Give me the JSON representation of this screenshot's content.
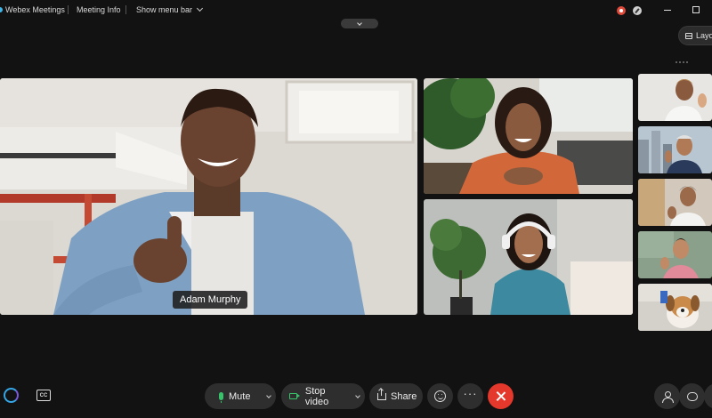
{
  "window": {
    "app_title": "Webex Meetings",
    "meeting_info_label": "Meeting Info",
    "menu_bar_label": "Show menu bar"
  },
  "top_controls": {
    "layout_label": "Layout"
  },
  "stage": {
    "active_speaker_name": "Adam Murphy"
  },
  "controls": {
    "mute_label": "Mute",
    "stop_video_label": "Stop video",
    "share_label": "Share",
    "more_label": "···",
    "cc_label": "CC"
  },
  "colors": {
    "background": "#121212",
    "control_bg": "#2e2e2e",
    "end_call": "#e3382b",
    "active_green": "#36c36a"
  },
  "icons": [
    "webex-logo-icon",
    "record-icon",
    "mic-status-icon",
    "minimize-icon",
    "maximize-icon",
    "chevron-down-icon",
    "layout-icon",
    "closed-captions-icon",
    "microphone-icon",
    "camera-icon",
    "share-icon",
    "reactions-icon",
    "more-icon",
    "end-call-icon",
    "participants-icon",
    "chat-icon"
  ]
}
